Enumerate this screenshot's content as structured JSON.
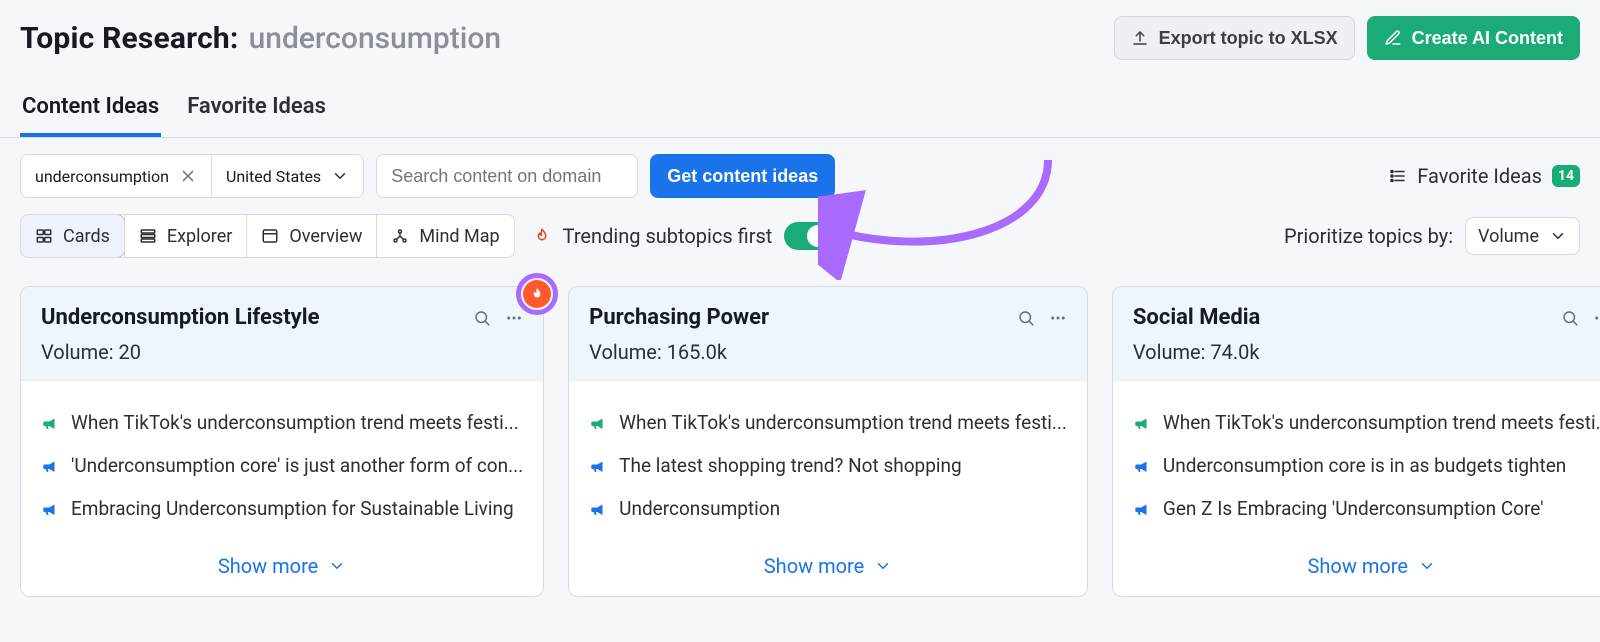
{
  "header": {
    "title_prefix": "Topic Research:",
    "topic": "underconsumption",
    "export_label": "Export topic to XLSX",
    "create_ai_label": "Create AI Content"
  },
  "tabs": {
    "content_ideas": "Content Ideas",
    "favorite_ideas": "Favorite Ideas",
    "active": "content_ideas"
  },
  "controls": {
    "topic_value": "underconsumption",
    "country_value": "United States",
    "domain_placeholder": "Search content on domain",
    "get_ideas_label": "Get content ideas",
    "favorite_ideas_label": "Favorite Ideas",
    "favorite_ideas_count": "14"
  },
  "viewbar": {
    "views": {
      "cards": "Cards",
      "explorer": "Explorer",
      "overview": "Overview",
      "mindmap": "Mind Map"
    },
    "trending_label": "Trending subtopics first",
    "trending_on": true,
    "prioritize_label": "Prioritize topics by:",
    "prioritize_value": "Volume"
  },
  "cards": [
    {
      "title": "Underconsumption Lifestyle",
      "volume_label": "Volume:",
      "volume_value": "20",
      "fire": true,
      "items": [
        {
          "type": "green",
          "text": "When TikTok's underconsumption trend meets festi..."
        },
        {
          "type": "blue",
          "text": "'Underconsumption core' is just another form of con..."
        },
        {
          "type": "blue",
          "text": "Embracing Underconsumption for Sustainable Living"
        }
      ],
      "show_more": "Show more"
    },
    {
      "title": "Purchasing Power",
      "volume_label": "Volume:",
      "volume_value": "165.0k",
      "fire": false,
      "items": [
        {
          "type": "green",
          "text": "When TikTok's underconsumption trend meets festi..."
        },
        {
          "type": "blue",
          "text": "The latest shopping trend? Not shopping"
        },
        {
          "type": "blue",
          "text": "Underconsumption"
        }
      ],
      "show_more": "Show more"
    },
    {
      "title": "Social Media",
      "volume_label": "Volume:",
      "volume_value": "74.0k",
      "fire": false,
      "items": [
        {
          "type": "green",
          "text": "When TikTok's underconsumption trend meets festi..."
        },
        {
          "type": "blue",
          "text": "Underconsumption core is in as budgets tighten"
        },
        {
          "type": "blue",
          "text": "Gen Z Is Embracing 'Underconsumption Core'"
        }
      ],
      "show_more": "Show more"
    }
  ]
}
